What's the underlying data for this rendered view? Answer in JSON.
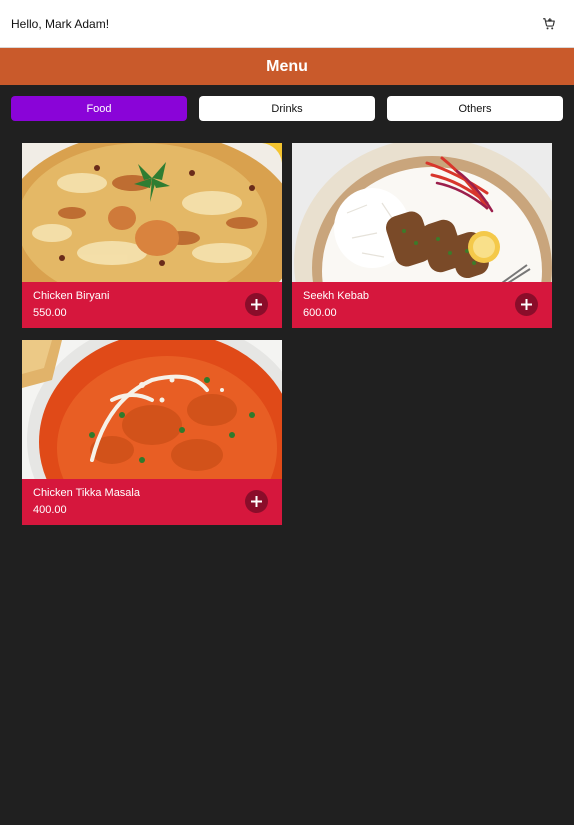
{
  "header": {
    "greeting": "Hello, Mark Adam!",
    "cart_icon": "cart-icon"
  },
  "menu": {
    "title": "Menu"
  },
  "tabs": [
    {
      "label": "Food",
      "active": true
    },
    {
      "label": "Drinks",
      "active": false
    },
    {
      "label": "Others",
      "active": false
    }
  ],
  "items": [
    {
      "name": "Chicken Biryani",
      "price": "550.00",
      "image": "biryani-photo"
    },
    {
      "name": "Seekh Kebab",
      "price": "600.00",
      "image": "kebab-photo"
    },
    {
      "name": "Chicken Tikka Masala",
      "price": "400.00",
      "image": "tikka-masala-photo"
    }
  ],
  "colors": {
    "background": "#202020",
    "menu_bar": "#c95a2b",
    "active_tab": "#8a04d8",
    "card": "#d6173d",
    "add_button": "#8a0d2a"
  }
}
